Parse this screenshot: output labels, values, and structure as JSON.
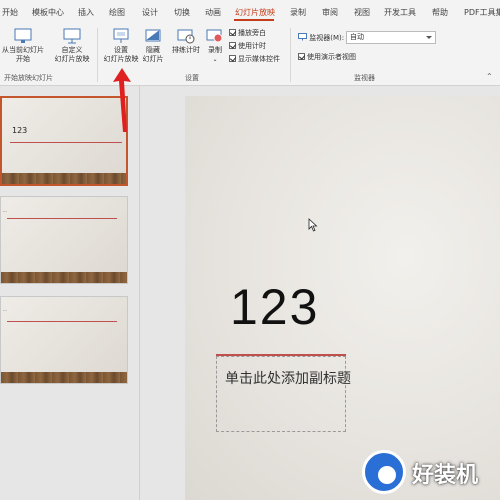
{
  "tabs": [
    {
      "label": "开始"
    },
    {
      "label": "模板中心"
    },
    {
      "label": "插入"
    },
    {
      "label": "绘图"
    },
    {
      "label": "设计"
    },
    {
      "label": "切换"
    },
    {
      "label": "动画"
    },
    {
      "label": "幻灯片放映"
    },
    {
      "label": "录制"
    },
    {
      "label": "审阅"
    },
    {
      "label": "视图"
    },
    {
      "label": "开发工具"
    },
    {
      "label": "帮助"
    },
    {
      "label": "PDF工具集"
    }
  ],
  "active_tab": "幻灯片放映",
  "ribbon": {
    "start_group": {
      "from_current": "从当前幻灯片\n开始",
      "custom": "自定义\n幻灯片放映",
      "label": "开始放映幻灯片"
    },
    "setup_group": {
      "setup": "设置\n幻灯片放映",
      "hide": "隐藏\n幻灯片",
      "rehearse": "排练计时",
      "record": "录制",
      "checks": [
        {
          "label": "播放旁白",
          "checked": true
        },
        {
          "label": "使用计时",
          "checked": true
        },
        {
          "label": "显示媒体控件",
          "checked": true
        }
      ],
      "label": "设置"
    },
    "monitor_group": {
      "monitor_label": "监视器(M):",
      "monitor_value": "自动",
      "presenter_view": "使用演示者视图",
      "presenter_checked": true,
      "label": "监视器"
    }
  },
  "thumbnails": [
    {
      "title": "123",
      "selected": true
    },
    {
      "title": "",
      "selected": false
    },
    {
      "title": "",
      "selected": false
    }
  ],
  "slide": {
    "title": "123",
    "subtitle_placeholder": "单击此处添加副标题"
  },
  "watermark": {
    "text": "好装机"
  },
  "colors": {
    "accent": "#c43e1c",
    "rule": "#c0504d",
    "arrow": "#e02020",
    "watermark_blue": "#2a6fd6"
  }
}
